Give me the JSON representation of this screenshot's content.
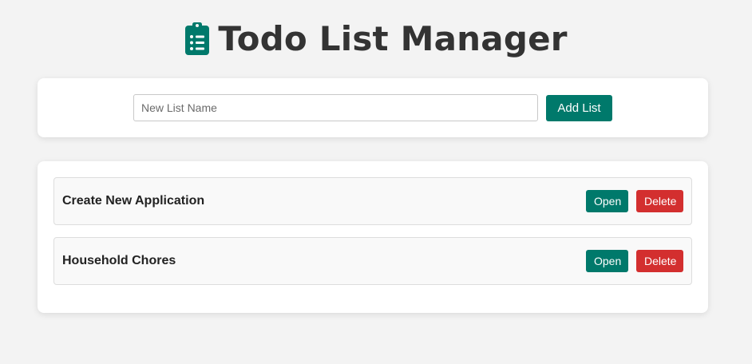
{
  "header": {
    "title": "Todo List Manager",
    "icon": "clipboard-list-icon",
    "icon_color": "#00796b"
  },
  "add_form": {
    "input_value": "",
    "input_placeholder": "New List Name",
    "add_button_label": "Add List"
  },
  "lists": {
    "items": [
      {
        "name": "Create New Application",
        "open_label": "Open",
        "delete_label": "Delete"
      },
      {
        "name": "Household Chores",
        "open_label": "Open",
        "delete_label": "Delete"
      }
    ]
  },
  "colors": {
    "primary": "#00796b",
    "danger": "#d32f2f",
    "background": "#f3f3f3"
  }
}
